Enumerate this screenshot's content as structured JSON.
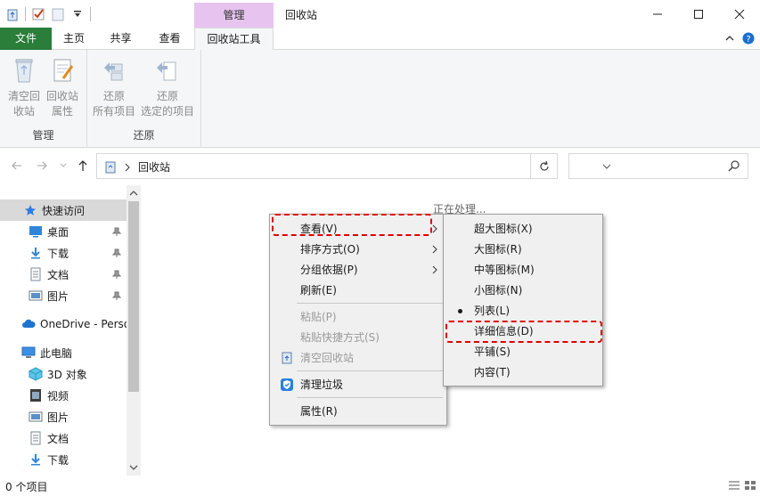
{
  "title_bar": {
    "context_tab": "管理",
    "window_title": "回收站"
  },
  "ribbon_tabs": {
    "file": "文件",
    "home": "主页",
    "share": "共享",
    "view": "查看",
    "recycle_tools": "回收站工具"
  },
  "ribbon": {
    "empty_bin": "清空回\n收站",
    "empty_bin_l1": "清空回",
    "empty_bin_l2": "收站",
    "bin_props_l1": "回收站",
    "bin_props_l2": "属性",
    "group_manage": "管理",
    "restore_all_l1": "还原",
    "restore_all_l2": "所有项目",
    "restore_sel_l1": "还原",
    "restore_sel_l2": "选定的项目",
    "group_restore": "还原"
  },
  "address": {
    "location": "回收站"
  },
  "nav_pane": {
    "quick_access": "快速访问",
    "desktop": "桌面",
    "downloads": "下载",
    "documents": "文档",
    "pictures": "图片",
    "onedrive": "OneDrive - Perso",
    "this_pc": "此电脑",
    "objects3d": "3D 对象",
    "videos": "视频",
    "pictures2": "图片",
    "documents2": "文档",
    "downloads2": "下载"
  },
  "content": {
    "working": "正在处理..."
  },
  "status_bar": {
    "items": "0 个项目"
  },
  "context_menu": {
    "view": "查看(V)",
    "sort_by": "排序方式(O)",
    "group_by": "分组依据(P)",
    "refresh": "刷新(E)",
    "paste": "粘贴(P)",
    "paste_shortcut": "粘贴快捷方式(S)",
    "empty_bin": "清空回收站",
    "clean_junk": "清理垃圾",
    "properties": "属性(R)"
  },
  "view_submenu": {
    "extra_large": "超大图标(X)",
    "large": "大图标(R)",
    "medium": "中等图标(M)",
    "small": "小图标(N)",
    "list": "列表(L)",
    "details": "详细信息(D)",
    "tiles": "平铺(S)",
    "content": "内容(T)",
    "selected": "列表(L)"
  },
  "colors": {
    "file_tab": "#2b7d3a",
    "context_tab": "#e7c4ef",
    "highlight": "#e00000"
  }
}
